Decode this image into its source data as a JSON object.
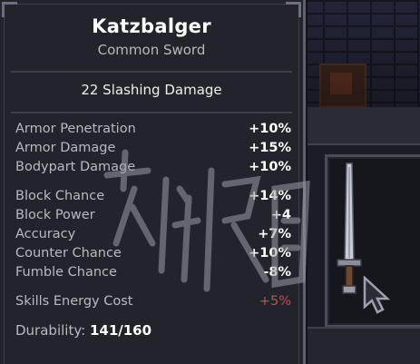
{
  "item": {
    "name": "Katzbalger",
    "type": "Common Sword",
    "damage": "22 Slashing Damage"
  },
  "stats_group1": [
    {
      "label": "Armor Penetration",
      "value": "+10%"
    },
    {
      "label": "Armor Damage",
      "value": "+15%"
    },
    {
      "label": "Bodypart Damage",
      "value": "+10%"
    }
  ],
  "stats_group2": [
    {
      "label": "Block Chance",
      "value": "+14%"
    },
    {
      "label": "Block Power",
      "value": "+4"
    },
    {
      "label": "Accuracy",
      "value": "+7%"
    },
    {
      "label": "Counter Chance",
      "value": "+10%"
    },
    {
      "label": "Fumble Chance",
      "value": "-8%"
    }
  ],
  "energy_cost": {
    "label": "Skills Energy Cost",
    "value": "+5%",
    "color": "#c24e4e"
  },
  "durability": {
    "label": "Durability:",
    "value": "141/160"
  },
  "colors": {
    "panel_bg": "#23242b",
    "text_label": "#b9bac1",
    "text_value": "#ffffff",
    "negative": "#c24e4e"
  },
  "icons": [
    "sword-icon",
    "cursor-icon"
  ]
}
